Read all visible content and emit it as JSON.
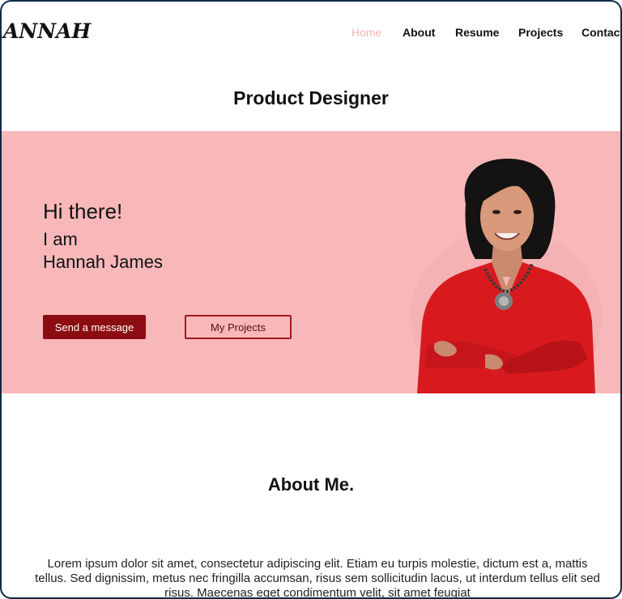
{
  "header": {
    "logo": "ANNAH",
    "nav": [
      "Home",
      "About",
      "Resume",
      "Projects",
      "Contact"
    ],
    "active_nav": "Home"
  },
  "role_title": "Product Designer",
  "hero": {
    "greeting": "Hi there!",
    "intro_line1": "I am",
    "intro_line2": "Hannah James",
    "primary_button": "Send a message",
    "secondary_button": "My Projects",
    "colors": {
      "background": "#f8b8ba",
      "primary_button": "#8b0d12",
      "outline_button_border": "#a3181d"
    }
  },
  "about": {
    "title": "About Me.",
    "paragraph": "Lorem ipsum dolor sit amet, consectetur adipiscing elit. Etiam eu turpis molestie, dictum est a, mattis tellus. Sed dignissim, metus nec fringilla accumsan, risus sem sollicitudin lacus, ut interdum tellus elit sed risus. Maecenas eget condimentum velit, sit amet feugiat"
  }
}
